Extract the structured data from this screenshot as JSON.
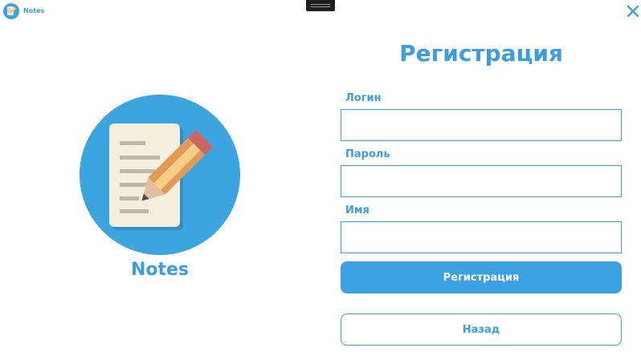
{
  "app": {
    "title": "Notes",
    "accent_color": "#3ba1e0",
    "icon": "notepad-pencil-icon"
  },
  "titlebar": {
    "close_icon": "close-icon",
    "drag_icon": "drag-handle-icon"
  },
  "logo": {
    "icon": "notepad-pencil-icon",
    "label": "Notes"
  },
  "form": {
    "title": "Регистрация",
    "login": {
      "label": "Логин",
      "value": "",
      "placeholder": ""
    },
    "password": {
      "label": "Пароль",
      "value": "",
      "placeholder": ""
    },
    "name": {
      "label": "Имя",
      "value": "",
      "placeholder": ""
    },
    "submit_label": "Регистрация",
    "back_label": "Назад"
  }
}
